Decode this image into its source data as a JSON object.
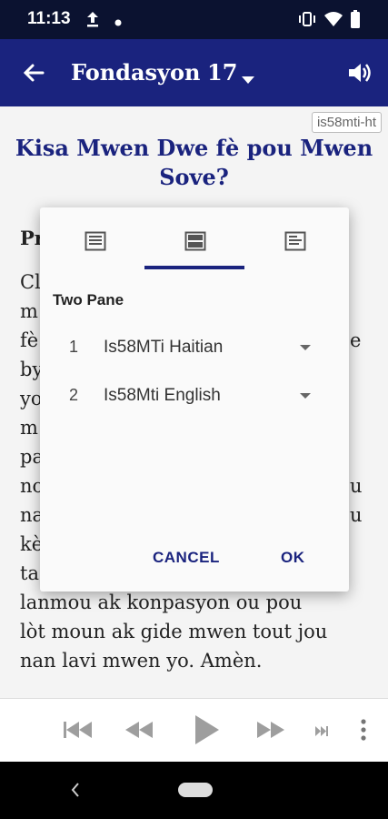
{
  "status_bar": {
    "time": "11:13",
    "icons": [
      "upload-icon",
      "dot-icon",
      "vibrate-icon",
      "wifi-icon",
      "battery-icon"
    ]
  },
  "app_bar": {
    "book": "Fondasyon",
    "chapter": "17",
    "icons": [
      "back-arrow-icon",
      "dropdown-caret-icon",
      "volume-icon"
    ]
  },
  "content": {
    "version_tag": "is58mti-ht",
    "heading": "Kisa Mwen Dwe fè pou Mwen Sove?",
    "visible_lines": [
      {
        "text": "Pr",
        "bold": true
      },
      {
        "text": "Cl"
      },
      {
        "text": "m"
      },
      {
        "text": "fè",
        "tail": "e"
      },
      {
        "text": "by"
      },
      {
        "text": "yo"
      },
      {
        "text": "m"
      },
      {
        "text": "pa"
      },
      {
        "text": "no",
        "tail": "u"
      },
      {
        "text": "na",
        "tail": "u"
      },
      {
        "text": "kè"
      },
      {
        "text": "ta"
      },
      {
        "text": "lanmou ak konpasyon ou pou"
      },
      {
        "text": "lòt moun ak gide mwen tout jou"
      },
      {
        "text": "nan lavi mwen yo. Amèn."
      }
    ]
  },
  "dialog": {
    "tabs": [
      {
        "name": "single-pane",
        "icon": "single-pane-icon",
        "selected": false
      },
      {
        "name": "two-pane",
        "icon": "two-pane-icon",
        "selected": true
      },
      {
        "name": "verse-by-verse",
        "icon": "verse-list-icon",
        "selected": false
      }
    ],
    "title": "Two Pane",
    "rows": [
      {
        "number": "1",
        "version": "Is58MTi Haitian"
      },
      {
        "number": "2",
        "version": "Is58Mti English"
      }
    ],
    "cancel_label": "CANCEL",
    "ok_label": "OK"
  },
  "player": {
    "icons": [
      "skip-previous-icon",
      "rewind-icon",
      "play-icon",
      "fast-forward-icon",
      "skip-next-small-icon",
      "more-vert-icon"
    ]
  },
  "colors": {
    "accent": "#1a237e",
    "status_bar": "#0b1230",
    "background": "#f4f4f4"
  }
}
